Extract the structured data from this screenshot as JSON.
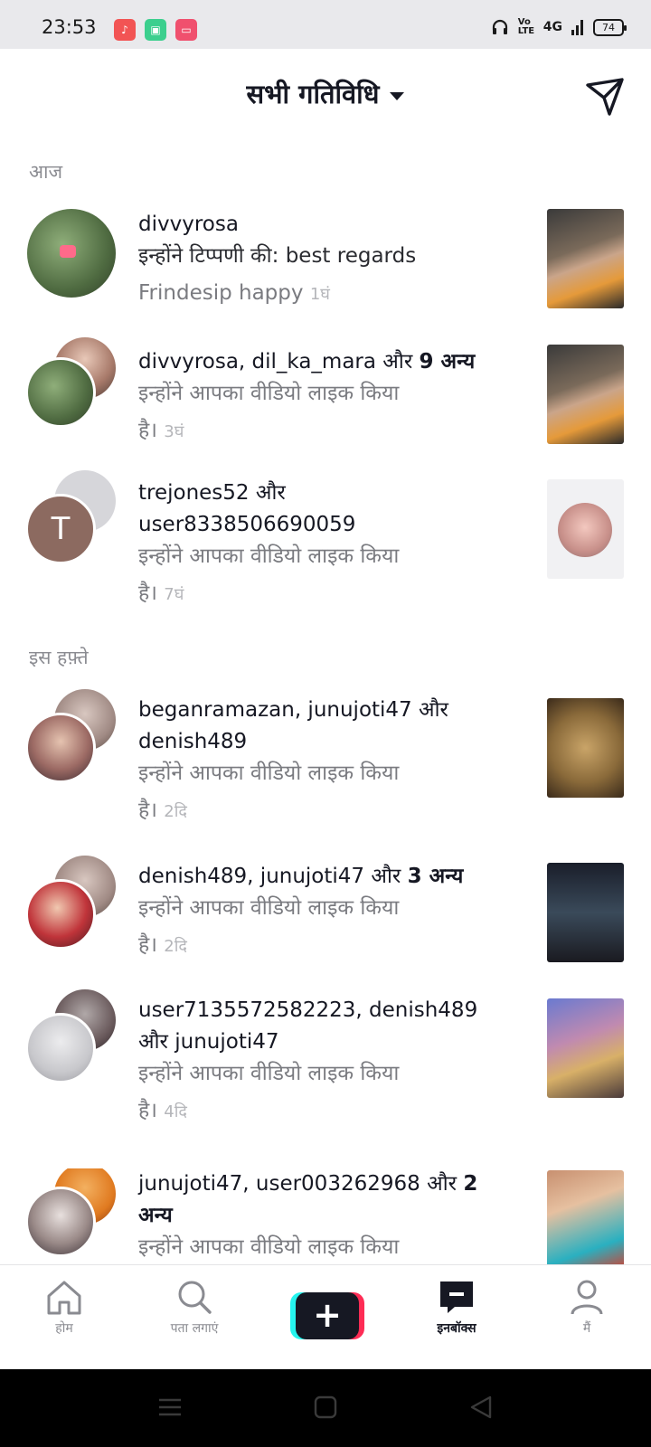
{
  "status_bar": {
    "time": "23:53",
    "signal": "4G",
    "volte": "Vo LTE",
    "battery": "74"
  },
  "header": {
    "title": "सभी गतिविधि",
    "send_icon": "send-plane-icon"
  },
  "sections": {
    "today": "आज",
    "this_week": "इस हफ़्ते"
  },
  "notifications": [
    {
      "names": "divvyrosa",
      "line2": "इन्होंने टिप्पणी की: best regards",
      "line3": "Frindesip happy",
      "time": "1घं"
    },
    {
      "names": "divvyrosa, dil_ka_mara",
      "and": "और",
      "extra": "9 अन्य",
      "line2": "इन्होंने आपका वीडियो लाइक किया",
      "line3": "है।",
      "time": "3घं"
    },
    {
      "names": "trejones52",
      "and": "और",
      "names2": "user8338506690059",
      "line2": "इन्होंने आपका वीडियो लाइक किया",
      "line3": "है।",
      "time": "7घं",
      "avatar_letter": "T"
    },
    {
      "names": "beganramazan, junujoti47",
      "and": "और",
      "names2": "denish489",
      "line2": "इन्होंने आपका वीडियो लाइक किया",
      "line3": "है।",
      "time": "2दि"
    },
    {
      "names": "denish489, junujoti47",
      "and": "और",
      "extra": "3 अन्य",
      "line2": "इन्होंने आपका वीडियो लाइक किया",
      "line3": "है।",
      "time": "2दि"
    },
    {
      "names": "user7135572582223, denish489",
      "and": "और",
      "names2": "junujoti47",
      "line2": "इन्होंने आपका वीडियो लाइक किया",
      "line3": "है।",
      "time": "4दि"
    },
    {
      "names": "junujoti47, user003262968",
      "and": "और",
      "extra": "2",
      "extra2": "अन्य",
      "line2": "इन्होंने आपका वीडियो लाइक किया"
    }
  ],
  "bottom_nav": {
    "home": "होम",
    "discover": "पता लगाएं",
    "inbox": "इनबॉक्स",
    "me": "मैं"
  },
  "colors": {
    "accent_red": "#fe2c55",
    "accent_cyan": "#25f4ee",
    "text_primary": "#161823",
    "text_secondary": "#7a7b80"
  }
}
